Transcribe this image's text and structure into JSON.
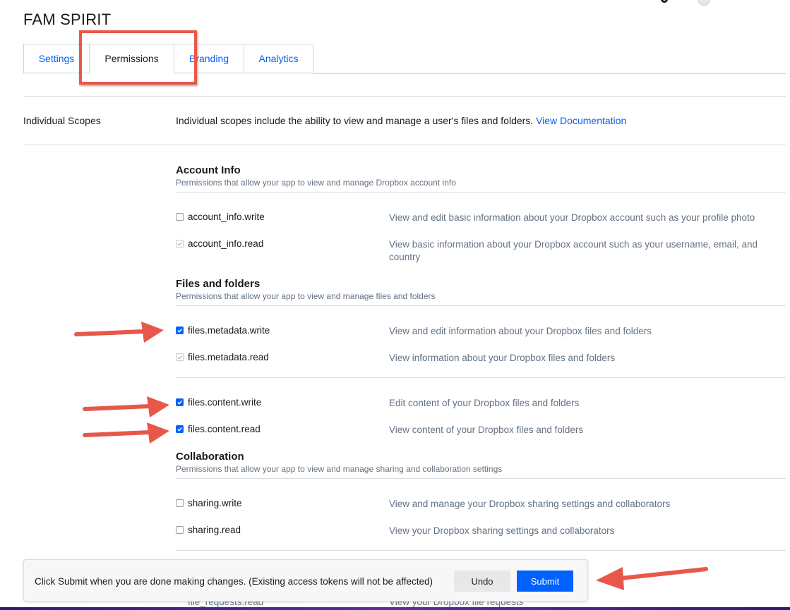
{
  "app": {
    "title": "FAM SPIRIT"
  },
  "tabs": [
    {
      "label": "Settings"
    },
    {
      "label": "Permissions"
    },
    {
      "label": "Branding"
    },
    {
      "label": "Analytics"
    }
  ],
  "intro": {
    "label": "Individual Scopes",
    "description": "Individual scopes include the ability to view and manage a user's files and folders.",
    "link": "View Documentation"
  },
  "sections": [
    {
      "title": "Account Info",
      "subtitle": "Permissions that allow your app to view and manage Dropbox account info",
      "scopes": [
        {
          "name": "account_info.write",
          "desc": "View and edit basic information about your Dropbox account such as your profile photo",
          "state": "unchecked"
        },
        {
          "name": "account_info.read",
          "desc": "View basic information about your Dropbox account such as your username, email, and country",
          "state": "checked-disabled"
        }
      ]
    },
    {
      "title": "Files and folders",
      "subtitle": "Permissions that allow your app to view and manage files and folders",
      "scopes": [
        {
          "name": "files.metadata.write",
          "desc": "View and edit information about your Dropbox files and folders",
          "state": "checked"
        },
        {
          "name": "files.metadata.read",
          "desc": "View information about your Dropbox files and folders",
          "state": "checked-disabled"
        },
        {
          "name": "files.content.write",
          "desc": "Edit content of your Dropbox files and folders",
          "state": "checked"
        },
        {
          "name": "files.content.read",
          "desc": "View content of your Dropbox files and folders",
          "state": "checked"
        }
      ]
    },
    {
      "title": "Collaboration",
      "subtitle": "Permissions that allow your app to view and manage sharing and collaboration settings",
      "scopes": [
        {
          "name": "sharing.write",
          "desc": "View and manage your Dropbox sharing settings and collaborators",
          "state": "unchecked"
        },
        {
          "name": "sharing.read",
          "desc": "View your Dropbox sharing settings and collaborators",
          "state": "unchecked"
        },
        {
          "name": "file_requests.read",
          "desc": "View your Dropbox file requests",
          "state": "unchecked"
        }
      ]
    }
  ],
  "bottom_bar": {
    "message": "Click Submit when you are done making changes. (Existing access tokens will not be affected)",
    "undo": "Undo",
    "submit": "Submit"
  },
  "colors": {
    "accent": "#0061fe",
    "annotation": "#e8584a"
  }
}
